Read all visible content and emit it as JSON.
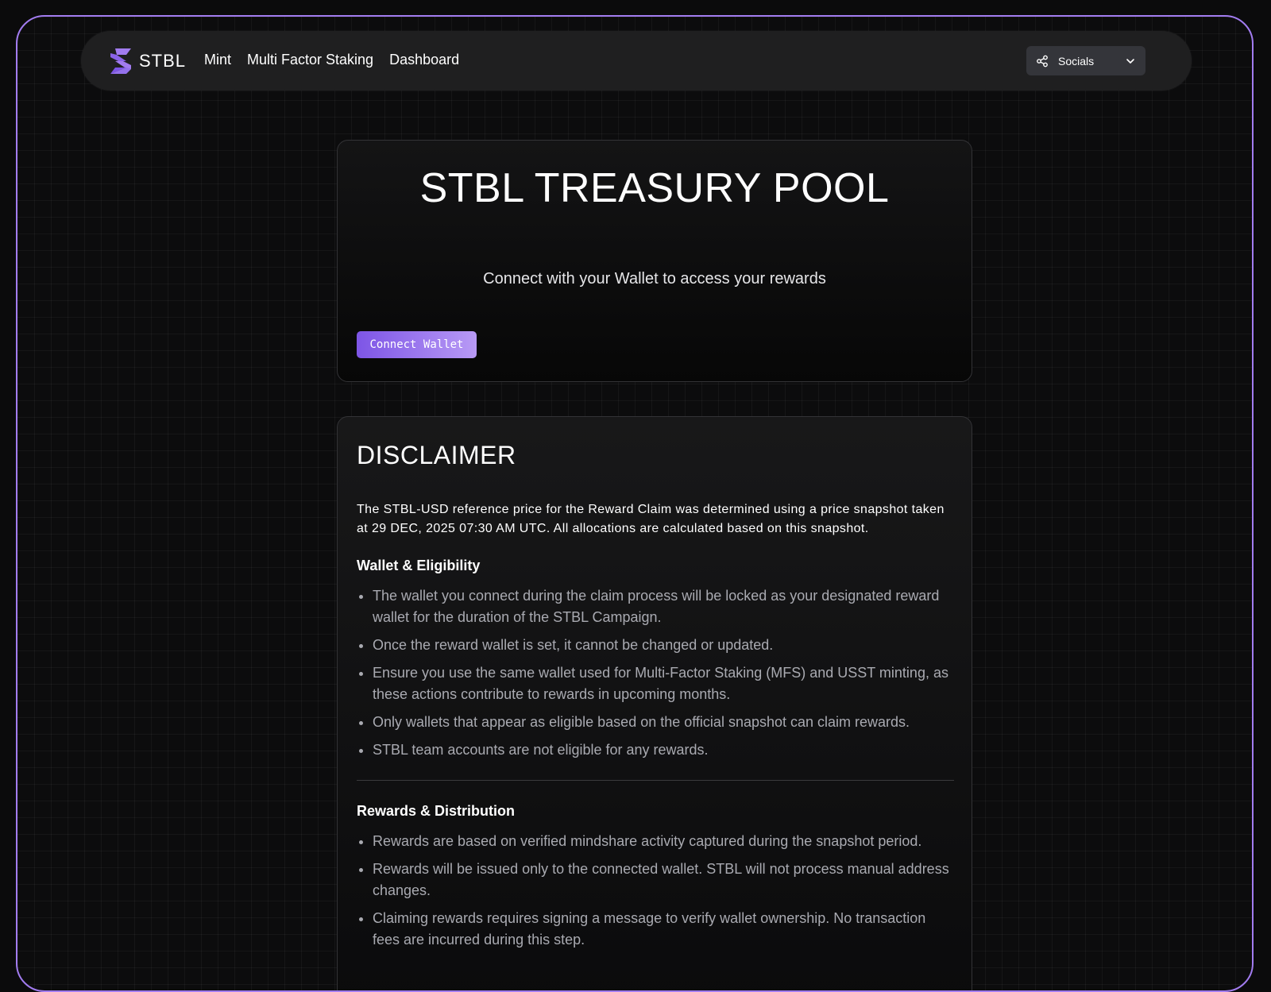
{
  "brand": {
    "name": "STBL",
    "accent": "#a27cf0",
    "logo_icon": "stbl-s-logo-icon"
  },
  "nav": {
    "links": [
      {
        "label": "Mint"
      },
      {
        "label": "Multi Factor Staking"
      },
      {
        "label": "Dashboard"
      }
    ],
    "socials": {
      "label": "Socials",
      "icon": "share-icon"
    }
  },
  "hero": {
    "title": "STBL TREASURY POOL",
    "subtitle": "Connect with your Wallet to access your rewards",
    "button_label": "Connect Wallet"
  },
  "disclaimer": {
    "title": "DISCLAIMER",
    "intro": "The STBL-USD reference price for the Reward Claim was determined using a price snapshot taken at 29 DEC, 2025 07:30 AM UTC. All allocations are calculated based on this snapshot.",
    "sections": [
      {
        "title": "Wallet & Eligibility",
        "items": [
          "The wallet you connect during the claim process will be locked as your designated reward wallet for the duration of the STBL Campaign.",
          "Once the reward wallet is set, it cannot be changed or updated.",
          "Ensure you use the same wallet used for Multi-Factor Staking (MFS) and USST minting, as these actions contribute to rewards in upcoming months.",
          "Only wallets that appear as eligible based on the official snapshot can claim rewards.",
          "STBL team accounts are not eligible for any rewards."
        ]
      },
      {
        "title": "Rewards & Distribution",
        "items": [
          "Rewards are based on verified mindshare activity captured during the snapshot period.",
          "Rewards will be issued only to the connected wallet. STBL will not process manual address changes.",
          "Claiming rewards requires signing a message to verify wallet ownership. No transaction fees are incurred during this step."
        ]
      }
    ]
  }
}
